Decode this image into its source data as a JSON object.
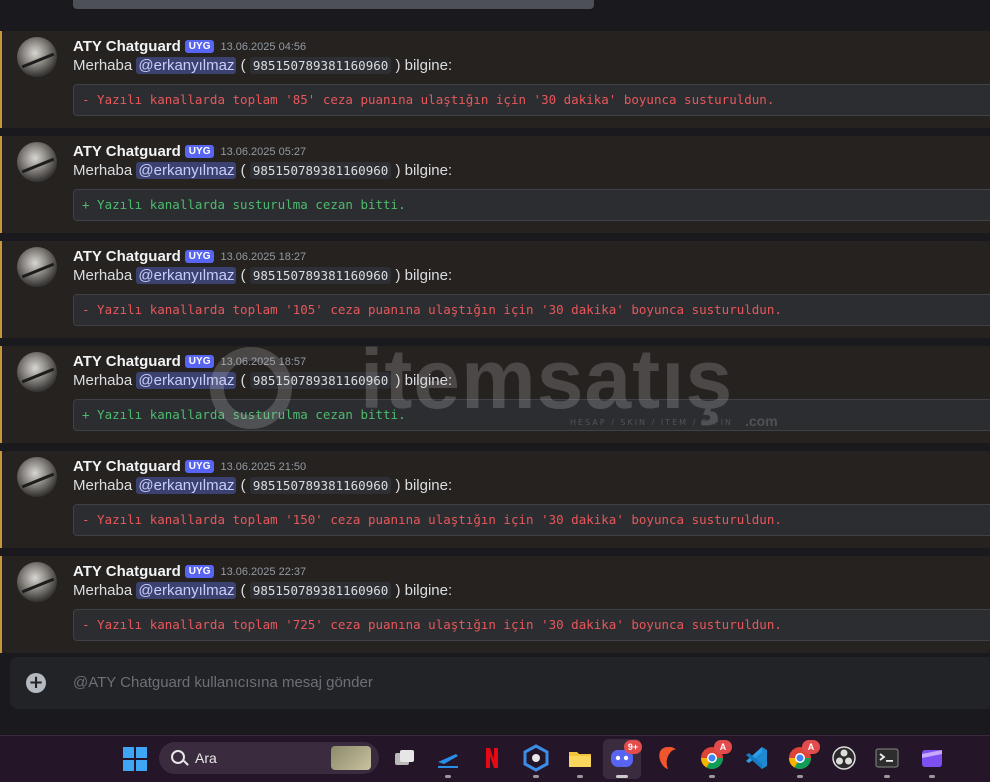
{
  "messages": [
    {
      "author": "ATY Chatguard",
      "tag": "UYG",
      "time": "13.06.2025 04:56",
      "greeting": "Merhaba",
      "mention": "@erkanyılmaz",
      "open_paren": "(",
      "user_id": "985150789381160960",
      "close_paren": ")",
      "suffix": "bilgine:",
      "code": "- Yazılı kanallarda toplam '85' ceza puanına ulaştığın için '30 dakika' boyunca susturuldun.",
      "kind": "red"
    },
    {
      "author": "ATY Chatguard",
      "tag": "UYG",
      "time": "13.06.2025 05:27",
      "greeting": "Merhaba",
      "mention": "@erkanyılmaz",
      "open_paren": "(",
      "user_id": "985150789381160960",
      "close_paren": ")",
      "suffix": "bilgine:",
      "code": "+ Yazılı kanallarda susturulma cezan bitti.",
      "kind": "green"
    },
    {
      "author": "ATY Chatguard",
      "tag": "UYG",
      "time": "13.06.2025 18:27",
      "greeting": "Merhaba",
      "mention": "@erkanyılmaz",
      "open_paren": "(",
      "user_id": "985150789381160960",
      "close_paren": ")",
      "suffix": "bilgine:",
      "code": "- Yazılı kanallarda toplam '105' ceza puanına ulaştığın için '30 dakika' boyunca susturuldun.",
      "kind": "red"
    },
    {
      "author": "ATY Chatguard",
      "tag": "UYG",
      "time": "13.06.2025 18:57",
      "greeting": "Merhaba",
      "mention": "@erkanyılmaz",
      "open_paren": "(",
      "user_id": "985150789381160960",
      "close_paren": ")",
      "suffix": "bilgine:",
      "code": "+ Yazılı kanallarda susturulma cezan bitti.",
      "kind": "green"
    },
    {
      "author": "ATY Chatguard",
      "tag": "UYG",
      "time": "13.06.2025 21:50",
      "greeting": "Merhaba",
      "mention": "@erkanyılmaz",
      "open_paren": "(",
      "user_id": "985150789381160960",
      "close_paren": ")",
      "suffix": "bilgine:",
      "code": "- Yazılı kanallarda toplam '150' ceza puanına ulaştığın için '30 dakika' boyunca susturuldun.",
      "kind": "red"
    },
    {
      "author": "ATY Chatguard",
      "tag": "UYG",
      "time": "13.06.2025 22:37",
      "greeting": "Merhaba",
      "mention": "@erkanyılmaz",
      "open_paren": "(",
      "user_id": "985150789381160960",
      "close_paren": ")",
      "suffix": "bilgine:",
      "code": "- Yazılı kanallarda toplam '725' ceza puanına ulaştığın için '30 dakika' boyunca susturuldun.",
      "kind": "red"
    }
  ],
  "composer": {
    "placeholder": "@ATY Chatguard kullanıcısına mesaj gönder",
    "plus": "+"
  },
  "watermark": {
    "brand": "itemsatış",
    "sub": "HESAP / SKIN / ITEM / E-PIN",
    "com": ".com"
  },
  "taskbar": {
    "search_label": "Ara",
    "discord_badge": "9+",
    "chrome_badge": "A",
    "chrome2_badge": "A",
    "icons": [
      "windows-start-icon",
      "search-icon",
      "task-view-icon",
      "airline-app-icon",
      "netflix-icon",
      "hex-app-icon",
      "file-explorer-icon",
      "discord-icon",
      "brave-icon",
      "chrome-icon",
      "vscode-icon",
      "chrome-profile-icon",
      "obs-icon",
      "terminal-icon",
      "clipchamp-icon"
    ]
  },
  "colors": {
    "accent": "#5865f2",
    "highlight_border": "#c8963c",
    "red_text": "#e8575a",
    "green_text": "#4dbb6e"
  }
}
